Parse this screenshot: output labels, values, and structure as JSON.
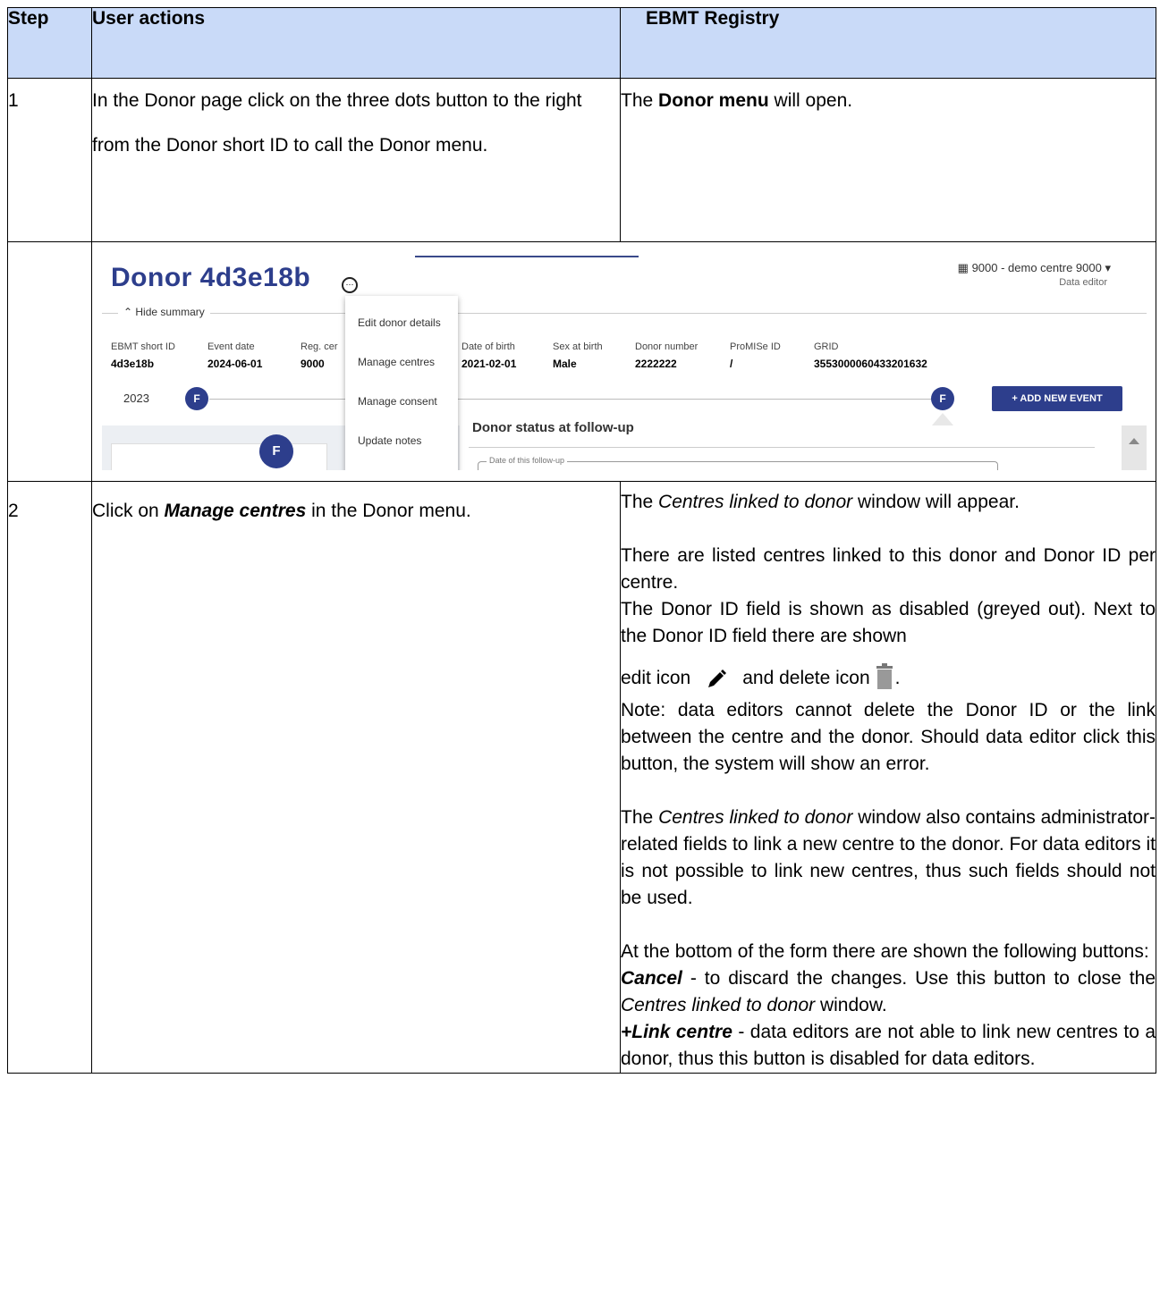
{
  "header": {
    "step": "Step",
    "user_actions": "User actions",
    "registry": "EBMT Registry"
  },
  "row1": {
    "step": "1",
    "action": "In the Donor page click on the three dots button to the right from the Donor short ID to call the Donor menu.",
    "result_pre": "The ",
    "result_bold": "Donor menu",
    "result_post": " will open."
  },
  "screenshot": {
    "donor_title": "Donor 4d3e18b",
    "centre_selector": "9000 - demo centre 9000",
    "role": "Data editor",
    "hide_summary": "Hide summary",
    "summary": [
      {
        "label": "EBMT short ID",
        "value": "4d3e18b"
      },
      {
        "label": "Event date",
        "value": "2024-06-01"
      },
      {
        "label": "Reg. cer",
        "value": "9000"
      },
      {
        "label": "Date of birth",
        "value": "2021-02-01"
      },
      {
        "label": "Sex at birth",
        "value": "Male"
      },
      {
        "label": "Donor number",
        "value": "2222222"
      },
      {
        "label": "ProMISe ID",
        "value": "/"
      },
      {
        "label": "GRID",
        "value": "3553000060433201632"
      }
    ],
    "year": "2023",
    "event_badge": "F",
    "add_event": "+ ADD NEW EVENT",
    "menu_items": [
      "Edit donor details",
      "Manage centres",
      "Manage consent",
      "Update notes"
    ],
    "form_title": "Donor status at follow-up",
    "field_label": "Date of this follow-up"
  },
  "row2": {
    "step": "2",
    "action_pre": "Click on ",
    "action_bold": "Manage centres",
    "action_post": "  in the Donor menu.",
    "p1_pre": "The ",
    "p1_em": "Centres linked to donor",
    "p1_post": " window will appear.",
    "p2": "There are listed centres linked to this donor and Donor ID per centre.",
    "p3": "The Donor ID field is shown as disabled (greyed out). Next to the Donor ID field there are shown",
    "p4_a": "edit icon",
    "p4_b": "and  delete icon",
    "p4_c": ".",
    "p5": "Note: data editors cannot delete the Donor ID or the link between the centre and the donor. Should data editor click this button, the system will show an error.",
    "p6_pre": "The ",
    "p6_em": "Centres linked to donor",
    "p6_post": " window also contains administrator-related fields to link a new centre to the donor. For data editors it is not possible to link new centres, thus such fields should not be used.",
    "p7": "At the bottom of the form there are shown the following buttons:",
    "cancel_label": "Cancel",
    "cancel_text_pre": " - to discard the changes. Use this button to close the ",
    "cancel_em": "Centres linked to donor",
    "cancel_text_post": " window.",
    "link_label": "+Link centre",
    "link_text": " - data editors are not able to link new centres to a donor, thus this button is disabled for data editors."
  }
}
